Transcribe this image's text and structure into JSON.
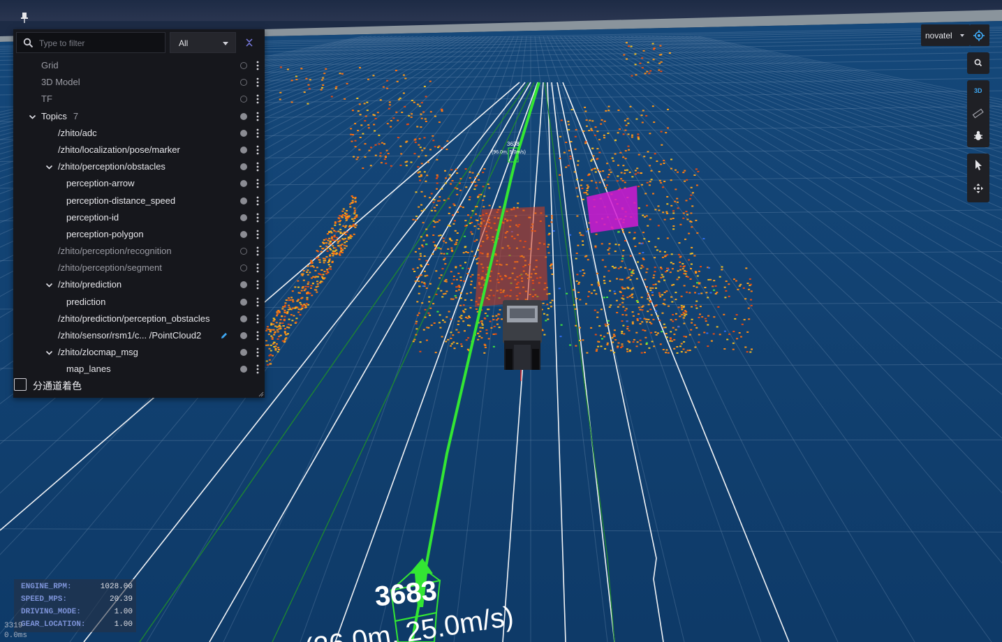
{
  "panel": {
    "search_placeholder": "Type to filter",
    "filter_select_value": "All",
    "items": [
      {
        "label": "Grid",
        "level": 0,
        "visible": false
      },
      {
        "label": "3D Model",
        "level": 0,
        "visible": false
      },
      {
        "label": "TF",
        "level": 0,
        "visible": false
      },
      {
        "label": "Topics",
        "count": "7",
        "level": 0,
        "expanded": true,
        "visible": true
      },
      {
        "label": "/zhito/adc",
        "level": 1,
        "visible": true
      },
      {
        "label": "/zhito/localization/pose/marker",
        "level": 1,
        "visible": true
      },
      {
        "label": "/zhito/perception/obstacles",
        "level": 1,
        "expanded": true,
        "visible": true
      },
      {
        "label": "perception-arrow",
        "level": 2,
        "visible": true
      },
      {
        "label": "perception-distance_speed",
        "level": 2,
        "visible": true
      },
      {
        "label": "perception-id",
        "level": 2,
        "visible": true
      },
      {
        "label": "perception-polygon",
        "level": 2,
        "visible": true
      },
      {
        "label": "/zhito/perception/recognition",
        "level": 1,
        "visible": false
      },
      {
        "label": "/zhito/perception/segment",
        "level": 1,
        "visible": false
      },
      {
        "label": "/zhito/prediction",
        "level": 1,
        "expanded": true,
        "visible": true
      },
      {
        "label": "prediction",
        "level": 2,
        "visible": true
      },
      {
        "label": "/zhito/prediction/perception_obstacles",
        "level": 1,
        "visible": true
      },
      {
        "label": "/zhito/sensor/rsm1/c... /PointCloud2",
        "level": 1,
        "visible": true,
        "editable": true
      },
      {
        "label": "/zhito/zlocmap_msg",
        "level": 1,
        "expanded": true,
        "visible": true
      },
      {
        "label": "map_lanes",
        "level": 2,
        "visible": true
      }
    ],
    "checkbox_label": "分通道着色"
  },
  "toolbar": {
    "frame_value": "novatel",
    "view_mode_label": "3D",
    "icons": [
      "pin-icon",
      "search-icon",
      "ruler-icon",
      "bug-icon",
      "cursor-icon",
      "move-icon",
      "crosshair-icon"
    ]
  },
  "scene": {
    "near_obstacle_id": "3683",
    "near_obstacle_info": "(26.0m, 25.0m/s)",
    "far_obstacle_id": "3638",
    "far_obstacle_info": "(96.0m, 5.0m/s)"
  },
  "stats": [
    {
      "key": "ENGINE_RPM:",
      "value": "1028.00"
    },
    {
      "key": "SPEED_MPS:",
      "value": "20.39"
    },
    {
      "key": "DRIVING_MODE:",
      "value": "1.00"
    },
    {
      "key": "GEAR_LOCATION:",
      "value": "1.00"
    }
  ],
  "perf": {
    "frame": "3319",
    "time": "0.0ms"
  },
  "colors": {
    "background": "#0d3a66",
    "panel": "#16171c",
    "accent": "#3fa9f5",
    "stat_key": "#7d93d8",
    "trajectory": "#33e633"
  }
}
